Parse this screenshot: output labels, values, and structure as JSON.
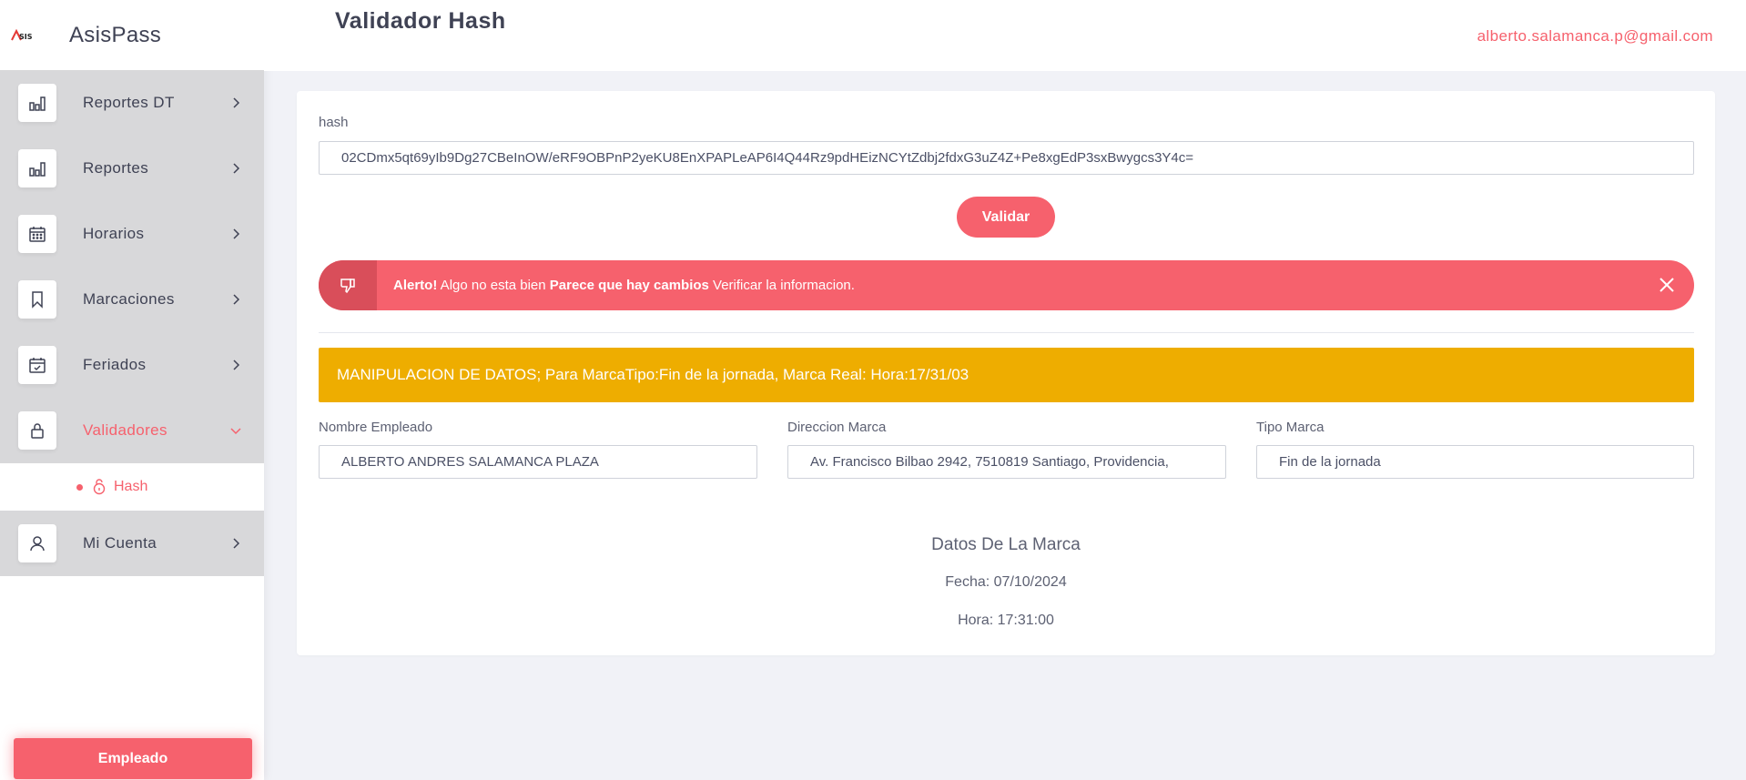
{
  "brand": {
    "logo_text": "ASIS",
    "name": "AsisPass"
  },
  "sidebar": {
    "items": [
      {
        "label": "Reportes DT",
        "icon": "bar-chart-icon"
      },
      {
        "label": "Reportes",
        "icon": "bar-chart-icon"
      },
      {
        "label": "Horarios",
        "icon": "calendar-icon"
      },
      {
        "label": "Marcaciones",
        "icon": "bookmark-icon"
      },
      {
        "label": "Feriados",
        "icon": "calendar-check-icon"
      },
      {
        "label": "Validadores",
        "icon": "lock-icon",
        "expanded": true
      },
      {
        "label": "Mi Cuenta",
        "icon": "user-icon"
      }
    ],
    "sub_items": [
      {
        "label": "Hash",
        "icon": "unlock-icon"
      }
    ],
    "footer_button": "Empleado"
  },
  "header": {
    "title": "Validador Hash",
    "user_email": "alberto.salamanca.p@gmail.com"
  },
  "form": {
    "hash_label": "hash",
    "hash_value": "02CDmx5qt69yIb9Dg27CBeInOW/eRF9OBPnP2yeKU8EnXPAPLeAP6I4Q44Rz9pdHEizNCYtZdbj2fdxG3uZ4Z+Pe8xgEdP3sxBwygcs3Y4c=",
    "validate_button": "Validar"
  },
  "alert": {
    "strong1": "Alerto!",
    "text1": " Algo no esta bien ",
    "strong2": "Parece que hay cambios",
    "text2": " Verificar la informacion."
  },
  "warning": "MANIPULACION DE DATOS; Para MarcaTipo:Fin de la jornada, Marca Real: Hora:17/31/03",
  "fields": [
    {
      "label": "Nombre Empleado",
      "value": "ALBERTO ANDRES SALAMANCA  PLAZA"
    },
    {
      "label": "Direccion Marca",
      "value": "Av. Francisco Bilbao 2942, 7510819 Santiago, Providencia,"
    },
    {
      "label": "Tipo Marca",
      "value": "Fin de la jornada"
    }
  ],
  "mark_data": {
    "title": "Datos De La Marca",
    "fecha": "Fecha: 07/10/2024",
    "hora": "Hora: 17:31:00"
  },
  "colors": {
    "accent": "#f6616d",
    "alert_dark": "#d94e5a",
    "warning": "#eead00",
    "sidebar_bg": "#d8d8da"
  }
}
